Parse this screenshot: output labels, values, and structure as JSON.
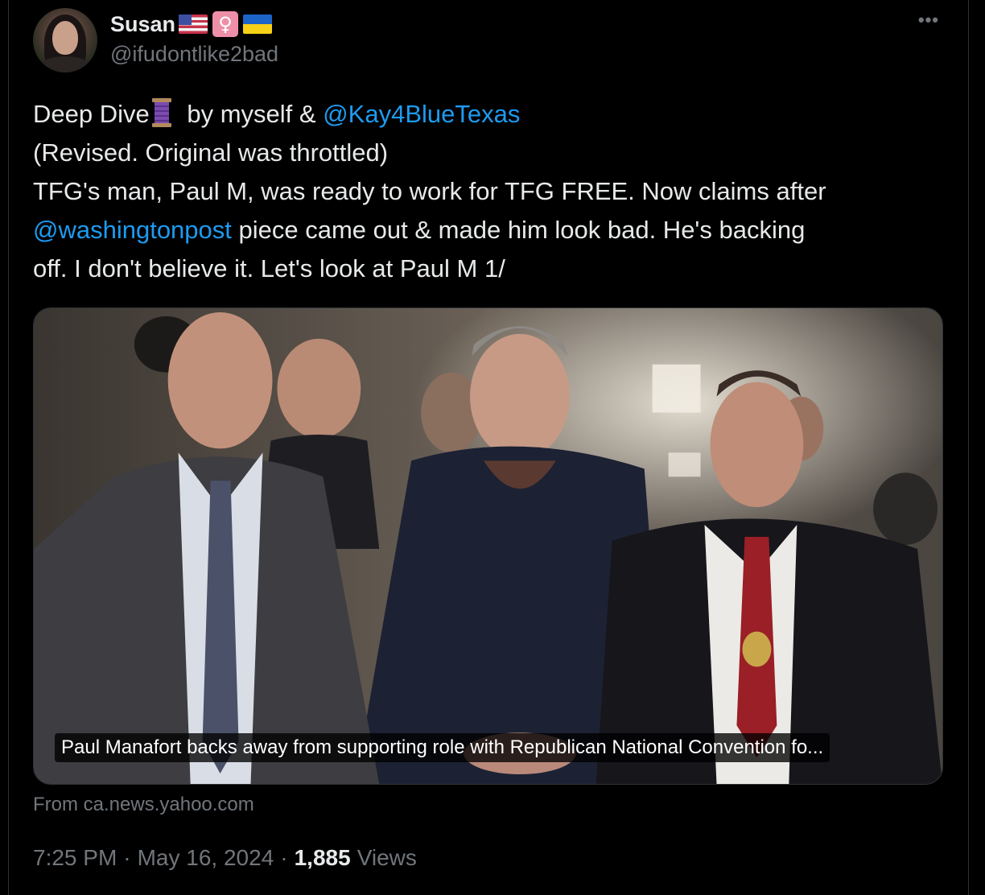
{
  "author": {
    "display_name": "Susan",
    "badges": [
      "flag-us-icon",
      "female-sign-icon",
      "flag-ua-icon"
    ],
    "handle": "@ifudontlike2bad"
  },
  "more_label": "•••",
  "tweet": {
    "line1_prefix": "Deep Dive",
    "line1_mid": " by myself & ",
    "mention1": "@Kay4BlueTexas",
    "line2": "(Revised. Original was throttled)",
    "line3": "TFG's man, Paul M, was ready to work for TFG FREE. Now claims after",
    "mention2": "@washingtonpost",
    "line4_rest": " piece came out & made him look bad. He's backing",
    "line5": "off. I don't believe it. Let's look at Paul M 1/"
  },
  "card": {
    "caption": "Paul Manafort backs away from supporting role with Republican National Convention fo...",
    "source": "From ca.news.yahoo.com"
  },
  "meta": {
    "time": "7:25 PM",
    "sep1": "·",
    "date": "May 16, 2024",
    "sep2": "·",
    "views_count": "1,885",
    "views_label": "Views"
  },
  "colors": {
    "background": "#000000",
    "text": "#e7e9ea",
    "secondary": "#71767b",
    "link": "#1d9bf0",
    "border": "#2f3336"
  }
}
